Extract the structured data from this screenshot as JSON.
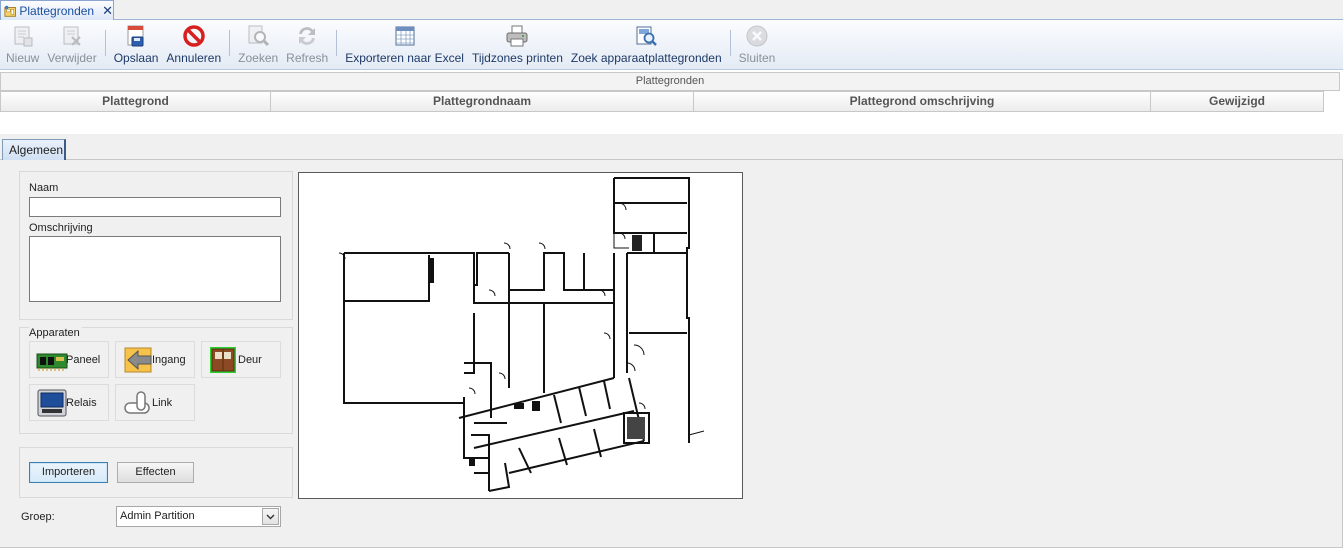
{
  "tab": {
    "title": "Plattegronden",
    "close": "✕"
  },
  "toolbar": {
    "nieuw": "Nieuw",
    "verwijder": "Verwijder",
    "opslaan": "Opslaan",
    "annuleren": "Annuleren",
    "zoeken": "Zoeken",
    "refresh": "Refresh",
    "exporteren": "Exporteren naar Excel",
    "tijdzones": "Tijdzones printen",
    "zoek_apparaat": "Zoek apparaatplattegronden",
    "sluiten": "Sluiten"
  },
  "grid": {
    "group_title": "Plattegronden",
    "columns": [
      "Plattegrond",
      "Plattegrondnaam",
      "Plattegrond omschrijving",
      "Gewijzigd"
    ]
  },
  "detail_tab": "Algemeen",
  "form": {
    "naam_label": "Naam",
    "naam_value": "",
    "omschrijving_label": "Omschrijving",
    "omschrijving_value": ""
  },
  "devices": {
    "title": "Apparaten",
    "paneel": "Paneel",
    "ingang": "Ingang",
    "deur": "Deur",
    "relais": "Relais",
    "link": "Link"
  },
  "actions": {
    "importeren": "Importeren",
    "effecten": "Effecten"
  },
  "groep": {
    "label": "Groep:",
    "value": "Admin Partition"
  },
  "colors": {
    "accent": "#1a4fa0",
    "toolbar_bg": "#e4ebf5",
    "cancel_red": "#d81f1f"
  }
}
